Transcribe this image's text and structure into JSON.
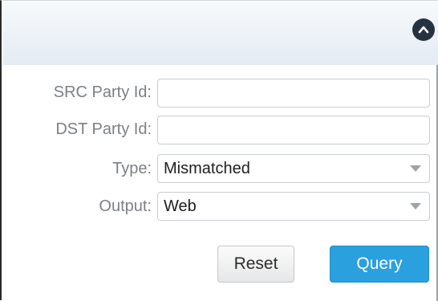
{
  "header": {
    "collapse_icon": "chevron-up-icon"
  },
  "form": {
    "src_party_id": {
      "label": "SRC Party Id:",
      "value": ""
    },
    "dst_party_id": {
      "label": "DST Party Id:",
      "value": ""
    },
    "type": {
      "label": "Type:",
      "selected": "Mismatched"
    },
    "output": {
      "label": "Output:",
      "selected": "Web"
    }
  },
  "actions": {
    "reset_label": "Reset",
    "query_label": "Query"
  },
  "colors": {
    "primary": "#2aa0df",
    "header_gradient_top": "#f7fafc",
    "header_gradient_bottom": "#e4ebf2",
    "collapse_button": "#253240",
    "label_text": "#7b8087"
  }
}
